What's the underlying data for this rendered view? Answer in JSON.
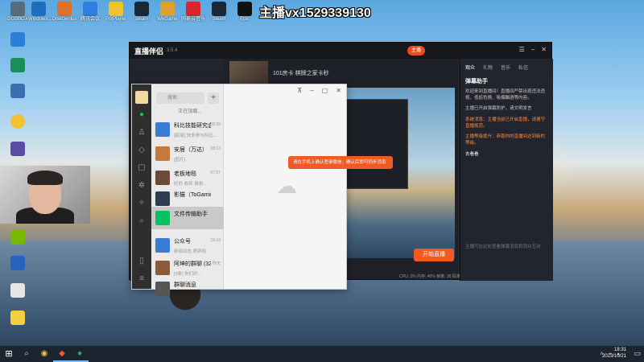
{
  "overlay": {
    "text": "主播vx1529339130"
  },
  "desktop_icons": [
    {
      "label": "DOSBOX"
    },
    {
      "label": "i-Windows..."
    },
    {
      "label": "DiskGenius"
    },
    {
      "label": "腾讯会议"
    },
    {
      "label": "PotPlayer"
    },
    {
      "label": "steam"
    },
    {
      "label": "WeGame"
    },
    {
      "label": "网易云音乐"
    },
    {
      "label": "Steam"
    },
    {
      "label": "Epic"
    }
  ],
  "stream_app": {
    "title": "直播伴侣",
    "version": "3.5.4",
    "live_badge": "主播",
    "room_title": "101房卡 棋牌之家卡秒",
    "start_button": "开始直播",
    "stats": "CPU: 2% 内存: 40% 帧率: 30 码率: 0",
    "right_tabs": [
      "观众",
      "礼物",
      "音乐",
      "私信"
    ],
    "right_header": "弹幕助手",
    "messages": [
      {
        "text": "欢迎来到直播间！直播间严禁出现违法违规、低俗色情、吸烟酗酒等内容。",
        "color": "grey"
      },
      {
        "text": "主播已开启弹幕防护，请文明发言",
        "color": "grey"
      },
      {
        "text": "系统消息：主播当前已开启直播，请遵守直播规范。",
        "color": "orange"
      },
      {
        "text": "主播等级提升：恭喜你的直播间达到新的等级。",
        "color": "orange"
      },
      {
        "text": "去看看",
        "color": "white"
      }
    ],
    "bottom_hint": "主播可在此处查看弹幕消息和观众互动"
  },
  "wechat": {
    "search_placeholder": "搜索",
    "loading": "正在加载...",
    "chats": [
      {
        "name": "科比技能研究会",
        "time": "08:35",
        "preview": "[链接] 快来参与科比...",
        "color": "#3a7bd5",
        "selected": false
      },
      {
        "name": "安居（万达）",
        "time": "08:13",
        "preview": "[图片]",
        "color": "#c47a3a",
        "selected": false
      },
      {
        "name": "老板地毯",
        "time": "07:57",
        "preview": "好的 收到 谢谢...",
        "color": "#6b4a3a",
        "selected": false
      },
      {
        "name": "影猫（ToGaming）",
        "time": "",
        "preview": "",
        "color": "#2c3e50",
        "selected": false
      },
      {
        "name": "文件传输助手",
        "time": "",
        "preview": "",
        "color": "#07c160",
        "selected": true
      },
      {
        "name": "公众号",
        "time": "16:18",
        "preview": "新闻动态 更新啦",
        "color": "#3a7bd5",
        "selected": false
      },
      {
        "name": "阿坤的群聊 (32)",
        "time": "昨天",
        "preview": "[3条] 你们好...",
        "color": "#8a5a3a",
        "selected": false
      },
      {
        "name": "群聊消息",
        "time": "",
        "preview": "",
        "color": "#555555",
        "selected": false
      }
    ],
    "toast": "请在手机上确认登录微信，确认后即可同步消息"
  },
  "taskbar": {
    "time": "18:31",
    "date": "2023/10/21",
    "apps": [
      "search",
      "chrome",
      "stream",
      "wechat"
    ]
  }
}
